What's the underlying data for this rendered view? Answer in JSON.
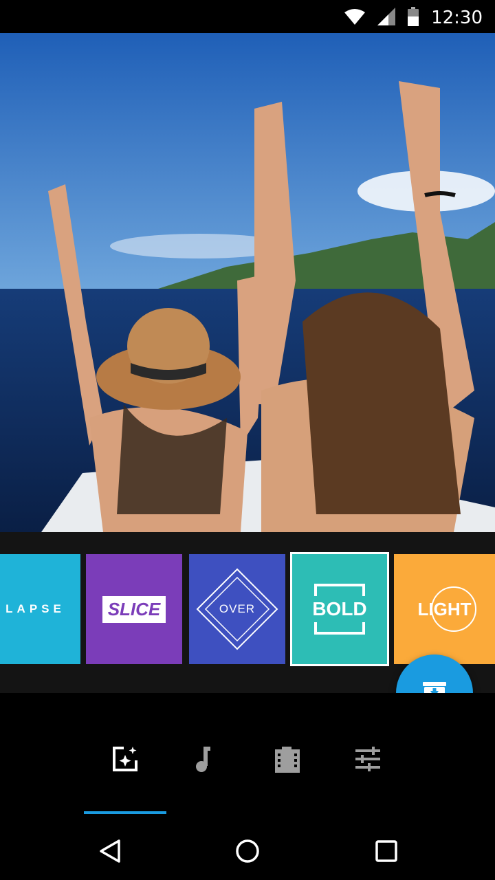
{
  "status_bar": {
    "time": "12:30",
    "icons": [
      "wifi-icon",
      "cell-signal-icon",
      "battery-icon"
    ]
  },
  "preview": {
    "description_icon": "video-preview"
  },
  "themes": [
    {
      "id": "lapse",
      "label": "LAPSE",
      "color": "#1fb3d8",
      "selected": false
    },
    {
      "id": "slice",
      "label": "SLICE",
      "color": "#7b3db9",
      "selected": false
    },
    {
      "id": "over",
      "label": "OVER",
      "color": "#3e50c0",
      "selected": false
    },
    {
      "id": "bold",
      "label": "BOLD",
      "color": "#2dbdb5",
      "selected": true
    },
    {
      "id": "light",
      "label": "LIGHT",
      "color": "#fbaa3a",
      "selected": false
    }
  ],
  "fab": {
    "icon": "save-to-archive-icon",
    "color": "#1a9be0"
  },
  "toolbar": {
    "tools": [
      {
        "id": "styles",
        "icon": "magic-style-icon",
        "active": true
      },
      {
        "id": "music",
        "icon": "music-note-icon",
        "active": false
      },
      {
        "id": "clips",
        "icon": "film-clips-icon",
        "active": false
      },
      {
        "id": "settings",
        "icon": "sliders-icon",
        "active": false
      }
    ],
    "accent_color": "#1a9be0"
  },
  "nav_bar": {
    "buttons": [
      "back-icon",
      "home-icon",
      "recents-icon"
    ]
  }
}
